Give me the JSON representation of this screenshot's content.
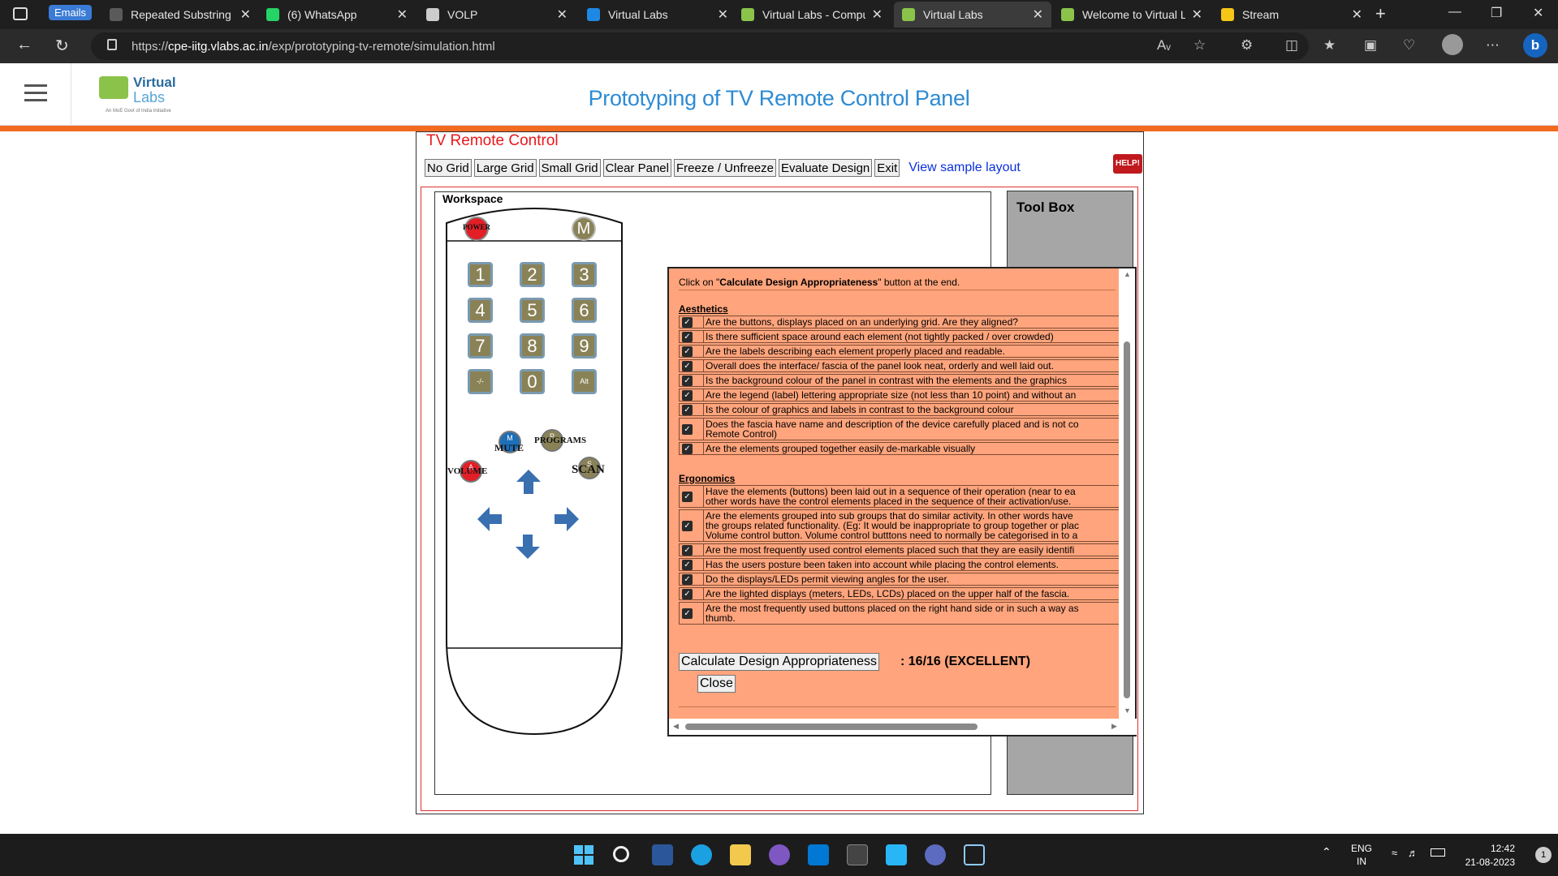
{
  "browser": {
    "emails_label": "Emails",
    "tabs": [
      {
        "title": "Repeated Substring P",
        "icon_color": "#5a5a5a",
        "active": false
      },
      {
        "title": "(6) WhatsApp",
        "icon_color": "#25d366",
        "active": false
      },
      {
        "title": "VOLP",
        "icon_color": "#cccccc",
        "active": false
      },
      {
        "title": "Virtual Labs",
        "icon_color": "#1e88e5",
        "active": false
      },
      {
        "title": "Virtual Labs - Compu",
        "icon_color": "#8bc34a",
        "active": false
      },
      {
        "title": "Virtual Labs",
        "icon_color": "#8bc34a",
        "active": true
      },
      {
        "title": "Welcome to Virtual L",
        "icon_color": "#8bc34a",
        "active": false
      },
      {
        "title": "Stream",
        "icon_color": "#f5c518",
        "active": false
      }
    ],
    "url_prefix": "https://",
    "url_host": "cpe-iitg.vlabs.ac.in",
    "url_path": "/exp/prototyping-tv-remote/simulation.html"
  },
  "site": {
    "logo_line1": "Virtual",
    "logo_line2": "Labs",
    "logo_tagline": "An MoE Govt of India Initiative",
    "title": "Prototyping of TV Remote Control Panel"
  },
  "sim": {
    "title": "TV Remote Control",
    "toolbar": {
      "no_grid": "No Grid",
      "large_grid": "Large Grid",
      "small_grid": "Small Grid",
      "clear_panel": "Clear Panel",
      "freeze": "Freeze / Unfreeze",
      "evaluate": "Evaluate Design",
      "exit": "Exit",
      "sample_layout": "View sample layout"
    },
    "help_label": "HELP!",
    "workspace_label": "Workspace",
    "toolbox_label": "Tool Box",
    "remote": {
      "power_label": "POWER",
      "menu_label": "M",
      "digits": [
        "1",
        "2",
        "3",
        "4",
        "5",
        "6",
        "7",
        "8",
        "9",
        "-/-",
        "0",
        "Alt"
      ],
      "mute_letter": "M",
      "mute_label": "MUTE",
      "programs_letter": "P",
      "programs_label": "PROGRAMS",
      "volume_letter": "A",
      "volume_label": "VOLUME",
      "scan_letter": "S",
      "scan_label": "SCAN"
    }
  },
  "evaluation": {
    "note_prefix": "Click on \"",
    "note_bold": "Calculate Design Appropriateness",
    "note_suffix": "\" button at the end.",
    "aesthetics_title": "Aesthetics",
    "aesthetics": [
      "Are the buttons, displays placed on an underlying grid. Are they aligned?",
      "Is there sufficient space around each element (not tightly packed / over crowded)",
      "Are the labels describing each element properly placed and readable.",
      "Overall does the interface/ fascia of the panel look neat, orderly and well laid out.",
      "Is the background colour of the panel in contrast with the elements and the graphics",
      "Are the legend (label) lettering appropriate size (not less than 10 point) and without an",
      "Is the colour of graphics and labels in contrast to the background colour",
      "Does the fascia have name and description of the device carefully placed and is not co\nRemote Control)",
      "Are the elements grouped together easily de-markable visually"
    ],
    "ergonomics_title": "Ergonomics",
    "ergonomics": [
      "Have the elements (buttons) been laid out in a sequence of their operation (near to ea\nother words have the control elements placed in the sequence of their activation/use.",
      "Are the elements grouped into sub groups that do similar activity. In other words have\nthe groups related functionality. (Eg: It would be inappropriate to group together or plac\nVolume control button. Volume control butttons need to normally be categorised in to a",
      "Are the most frequently used control elements placed such that they are easily identifi",
      "Has the users posture been taken into account while placing the control elements.",
      "Do the displays/LEDs permit viewing angles for the user.",
      "Are the lighted displays (meters, LEDs, LCDs) placed on the upper half of the fascia.",
      "Are the most frequently used buttons placed on the right hand side or in such a way as\nthumb."
    ],
    "calculate_label": "Calculate Design Appropriateness",
    "score_text": ": 16/16 (EXCELLENT)",
    "close_label": "Close"
  },
  "taskbar": {
    "lang_line1": "ENG",
    "lang_line2": "IN",
    "time": "12:42",
    "date": "21-08-2023",
    "notification_count": "1"
  }
}
